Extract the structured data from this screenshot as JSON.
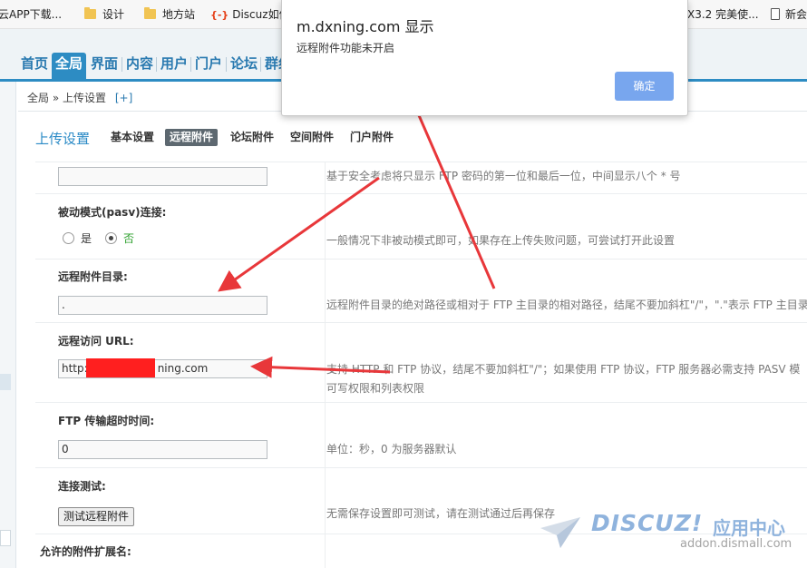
{
  "bookmarks": [
    {
      "label": "云APP下载...",
      "icon": "none"
    },
    {
      "label": "设计",
      "icon": "folder-icon"
    },
    {
      "label": "地方站",
      "icon": "folder-icon"
    },
    {
      "label": "Discuz如何",
      "icon": "discuz-icon",
      "badge": "{-}"
    },
    {
      "label": "X3.2 完美使...",
      "icon": "none"
    },
    {
      "label": "新会",
      "icon": "page-icon"
    }
  ],
  "admin_nav": [
    "首页",
    "全局",
    "界面",
    "内容",
    "用户",
    "门户",
    "论坛",
    "群组"
  ],
  "admin_nav_active": "全局",
  "breadcrumb": {
    "root": "全局",
    "sep": "»",
    "current": "上传设置",
    "add": "[+]"
  },
  "page_title": "上传设置",
  "subtabs": [
    "基本设置",
    "远程附件",
    "论坛附件",
    "空间附件",
    "门户附件"
  ],
  "subtab_active": "远程附件",
  "form": {
    "password_hint": "基于安全考虑将只显示 FTP 密码的第一位和最后一位，中间显示八个 * 号",
    "pasv": {
      "label": "被动模式(pasv)连接:",
      "options": [
        "是",
        "否"
      ],
      "selected": "否",
      "hint": "一般情况下非被动模式即可，如果存在上传失败问题，可尝试打开此设置"
    },
    "remote_dir": {
      "label": "远程附件目录:",
      "value": ".",
      "hint": "远程附件目录的绝对路径或相对于 FTP 主目录的相对路径，结尾不要加斜杠\"/\"，\".\"表示 FTP 主目录"
    },
    "remote_url": {
      "label": "远程访问 URL:",
      "value_prefix": "http:",
      "value_suffix": "ning.com",
      "hint_line1": "支持 HTTP 和 FTP 协议，结尾不要加斜杠\"/\"；如果使用 FTP 协议，FTP 服务器必需支持 PASV 模",
      "hint_line2": "可写权限和列表权限"
    },
    "timeout": {
      "label": "FTP 传输超时时间:",
      "value": "0",
      "hint": "单位：秒，0 为服务器默认"
    },
    "test": {
      "label": "连接测试:",
      "button": "测试远程附件",
      "hint": "无需保存设置即可测试，请在测试通过后再保存"
    },
    "allowed_ext_label": "允许的附件扩展名:"
  },
  "dialog": {
    "title": "m.dxning.com 显示",
    "message": "远程附件功能未开启",
    "ok": "确定"
  },
  "watermark": {
    "logo": "DISCUZ!",
    "cn": "应用中心",
    "url": "addon.dismall.com"
  },
  "colors": {
    "accent": "#2d8cc3",
    "annotation_arrow": "#e8373a",
    "redaction": "#ff1f1f",
    "dialog_button": "#78a6ee"
  }
}
